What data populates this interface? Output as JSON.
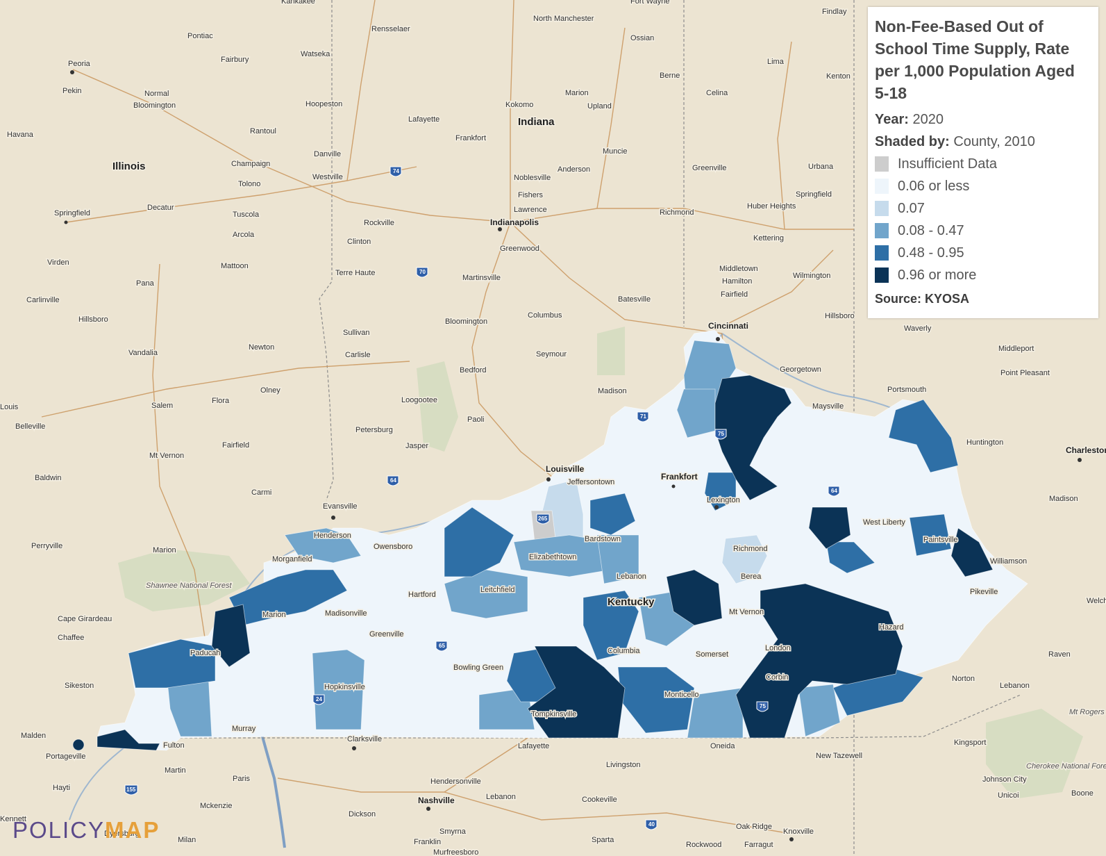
{
  "legend": {
    "title": "Non-Fee-Based Out of School Time Supply, Rate per 1,000 Population Aged 5-18",
    "year_label": "Year:",
    "year_value": "2020",
    "shaded_label": "Shaded by:",
    "shaded_value": "County, 2010",
    "items": [
      {
        "label": "Insufficient Data",
        "color": "#cdcdcd"
      },
      {
        "label": "0.06 or less",
        "color": "#eef5fb"
      },
      {
        "label": "0.07",
        "color": "#c6dbec"
      },
      {
        "label": "0.08 - 0.47",
        "color": "#71a5cb"
      },
      {
        "label": "0.48 - 0.95",
        "color": "#2e6fa6"
      },
      {
        "label": "0.96 or more",
        "color": "#0b3356"
      }
    ],
    "source": "Source: KYOSA"
  },
  "logo": {
    "part1": "POLICY",
    "part2": "MAP"
  },
  "states": [
    "Illinois",
    "Indiana",
    "Kentucky"
  ],
  "cities": [
    {
      "name": "Peoria"
    },
    {
      "name": "Pekin"
    },
    {
      "name": "Pontiac"
    },
    {
      "name": "Bloomington"
    },
    {
      "name": "Normal"
    },
    {
      "name": "Fairbury"
    },
    {
      "name": "Watseka"
    },
    {
      "name": "Kankakee"
    },
    {
      "name": "Rensselaer"
    },
    {
      "name": "Havana"
    },
    {
      "name": "Springfield"
    },
    {
      "name": "Decatur"
    },
    {
      "name": "Champaign"
    },
    {
      "name": "Rantoul"
    },
    {
      "name": "Danville"
    },
    {
      "name": "Hoopeston"
    },
    {
      "name": "Tolono"
    },
    {
      "name": "Tuscola"
    },
    {
      "name": "Arcola"
    },
    {
      "name": "Mattoon"
    },
    {
      "name": "Virden"
    },
    {
      "name": "Pana"
    },
    {
      "name": "Carlinville"
    },
    {
      "name": "Hillsboro"
    },
    {
      "name": "Vandalia"
    },
    {
      "name": "Newton"
    },
    {
      "name": "Olney"
    },
    {
      "name": "Flora"
    },
    {
      "name": "Salem"
    },
    {
      "name": "Louis"
    },
    {
      "name": "Belleville"
    },
    {
      "name": "Mt Vernon"
    },
    {
      "name": "Fairfield"
    },
    {
      "name": "Carmi"
    },
    {
      "name": "Baldwin"
    },
    {
      "name": "Perryville"
    },
    {
      "name": "Marion"
    },
    {
      "name": "Cape Girardeau"
    },
    {
      "name": "Chaffee"
    },
    {
      "name": "Sikeston"
    },
    {
      "name": "Malden"
    },
    {
      "name": "Portageville"
    },
    {
      "name": "Hayti"
    },
    {
      "name": "Kennett"
    },
    {
      "name": "Dyersburg"
    },
    {
      "name": "Milan"
    },
    {
      "name": "Mckenzie"
    },
    {
      "name": "Paris"
    },
    {
      "name": "Martin"
    },
    {
      "name": "Fulton"
    },
    {
      "name": "Murray"
    },
    {
      "name": "Paducah"
    },
    {
      "name": "Marion"
    },
    {
      "name": "Morganfield"
    },
    {
      "name": "Henderson"
    },
    {
      "name": "Evansville"
    },
    {
      "name": "Owensboro"
    },
    {
      "name": "Madisonville"
    },
    {
      "name": "Hopkinsville"
    },
    {
      "name": "Clarksville"
    },
    {
      "name": "Greenville"
    },
    {
      "name": "Hartford"
    },
    {
      "name": "Leitchfield"
    },
    {
      "name": "Bowling Green"
    },
    {
      "name": "Elizabethtown"
    },
    {
      "name": "Bardstown"
    },
    {
      "name": "Lebanon"
    },
    {
      "name": "Columbia"
    },
    {
      "name": "Tompkinsville"
    },
    {
      "name": "Monticello"
    },
    {
      "name": "Somerset"
    },
    {
      "name": "London"
    },
    {
      "name": "Corbin"
    },
    {
      "name": "Mt Vernon"
    },
    {
      "name": "Berea"
    },
    {
      "name": "Richmond"
    },
    {
      "name": "Lexington"
    },
    {
      "name": "Frankfort"
    },
    {
      "name": "Louisville"
    },
    {
      "name": "Jeffersontown"
    },
    {
      "name": "Madison"
    },
    {
      "name": "Cincinnati"
    },
    {
      "name": "Georgetown"
    },
    {
      "name": "Maysville"
    },
    {
      "name": "Portsmouth"
    },
    {
      "name": "Huntington"
    },
    {
      "name": "Charleston"
    },
    {
      "name": "Madison"
    },
    {
      "name": "West Liberty"
    },
    {
      "name": "Paintsville"
    },
    {
      "name": "Williamson"
    },
    {
      "name": "Pikeville"
    },
    {
      "name": "Hazard"
    },
    {
      "name": "Welch"
    },
    {
      "name": "Raven"
    },
    {
      "name": "Norton"
    },
    {
      "name": "Lebanon"
    },
    {
      "name": "Kingsport"
    },
    {
      "name": "Johnson City"
    },
    {
      "name": "Unicoi"
    },
    {
      "name": "Boone"
    },
    {
      "name": "New Tazewell"
    },
    {
      "name": "Oneida"
    },
    {
      "name": "Oak Ridge"
    },
    {
      "name": "Knoxville"
    },
    {
      "name": "Farragut"
    },
    {
      "name": "Rockwood"
    },
    {
      "name": "Sparta"
    },
    {
      "name": "Smyrna"
    },
    {
      "name": "Murfreesboro"
    },
    {
      "name": "Franklin"
    },
    {
      "name": "Nashville"
    },
    {
      "name": "Hendersonville"
    },
    {
      "name": "Lebanon"
    },
    {
      "name": "Cookeville"
    },
    {
      "name": "Livingston"
    },
    {
      "name": "Lafayette"
    },
    {
      "name": "Dickson"
    },
    {
      "name": "Indianapolis"
    },
    {
      "name": "Lawrence"
    },
    {
      "name": "Fishers"
    },
    {
      "name": "Noblesville"
    },
    {
      "name": "Anderson"
    },
    {
      "name": "Muncie"
    },
    {
      "name": "Kokomo"
    },
    {
      "name": "Lafayette"
    },
    {
      "name": "Frankfort"
    },
    {
      "name": "Marion"
    },
    {
      "name": "Upland"
    },
    {
      "name": "North Manchester"
    },
    {
      "name": "Fort Wayne"
    },
    {
      "name": "Ossian"
    },
    {
      "name": "Berne"
    },
    {
      "name": "Celina"
    },
    {
      "name": "Lima"
    },
    {
      "name": "Kenton"
    },
    {
      "name": "Findlay"
    },
    {
      "name": "Greenville"
    },
    {
      "name": "Urbana"
    },
    {
      "name": "Springfield"
    },
    {
      "name": "Huber Heights"
    },
    {
      "name": "Kettering"
    },
    {
      "name": "Middletown"
    },
    {
      "name": "Hamilton"
    },
    {
      "name": "Fairfield"
    },
    {
      "name": "Wilmington"
    },
    {
      "name": "Hillsboro"
    },
    {
      "name": "Waverly"
    },
    {
      "name": "Middleport"
    },
    {
      "name": "Point Pleasant"
    },
    {
      "name": "Richmond"
    },
    {
      "name": "Batesville"
    },
    {
      "name": "Columbus"
    },
    {
      "name": "Seymour"
    },
    {
      "name": "Bloomington"
    },
    {
      "name": "Martinsville"
    },
    {
      "name": "Greenwood"
    },
    {
      "name": "Terre Haute"
    },
    {
      "name": "Clinton"
    },
    {
      "name": "Rockville"
    },
    {
      "name": "Sullivan"
    },
    {
      "name": "Carlisle"
    },
    {
      "name": "Bedford"
    },
    {
      "name": "Loogootee"
    },
    {
      "name": "Paoli"
    },
    {
      "name": "Jasper"
    },
    {
      "name": "Petersburg"
    },
    {
      "name": "Westville"
    }
  ],
  "labels": {
    "shawnee": "Shawnee National Forest",
    "cherokee": "Cherokee National Forest",
    "mt_rogers": "Mt Rogers Recreat"
  }
}
